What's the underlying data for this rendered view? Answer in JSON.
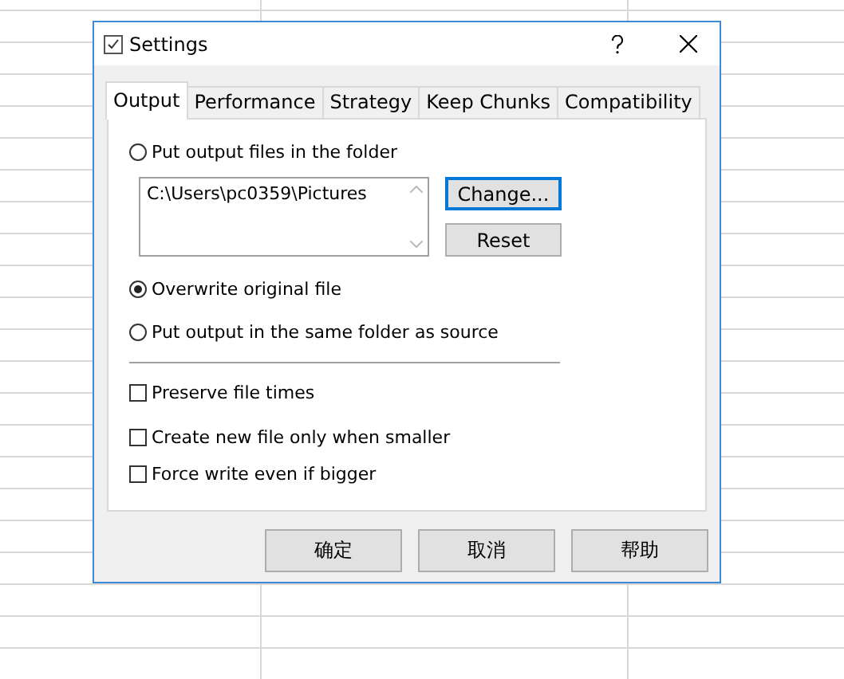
{
  "window": {
    "title": "Settings"
  },
  "tabs": [
    {
      "label": "Output",
      "selected": true
    },
    {
      "label": "Performance",
      "selected": false
    },
    {
      "label": "Strategy",
      "selected": false
    },
    {
      "label": "Keep Chunks",
      "selected": false
    },
    {
      "label": "Compatibility",
      "selected": false
    }
  ],
  "output_folder_option": {
    "label": "Put output files in the folder",
    "selected": false
  },
  "folder_field": {
    "value": "C:\\Users\\pc0359\\Pictures"
  },
  "folder_buttons": [
    "Change...",
    "Reset"
  ],
  "location_options": [
    {
      "label": "Overwrite original file",
      "selected": true
    },
    {
      "label": "Put output in the same folder as source",
      "selected": false
    }
  ],
  "checkboxes": [
    {
      "label": "Preserve file times",
      "checked": false
    },
    {
      "label": "Create new file only when smaller",
      "checked": false
    },
    {
      "label": "Force write even if bigger",
      "checked": false
    }
  ],
  "buttons": [
    "确定",
    "取消",
    "帮助"
  ]
}
